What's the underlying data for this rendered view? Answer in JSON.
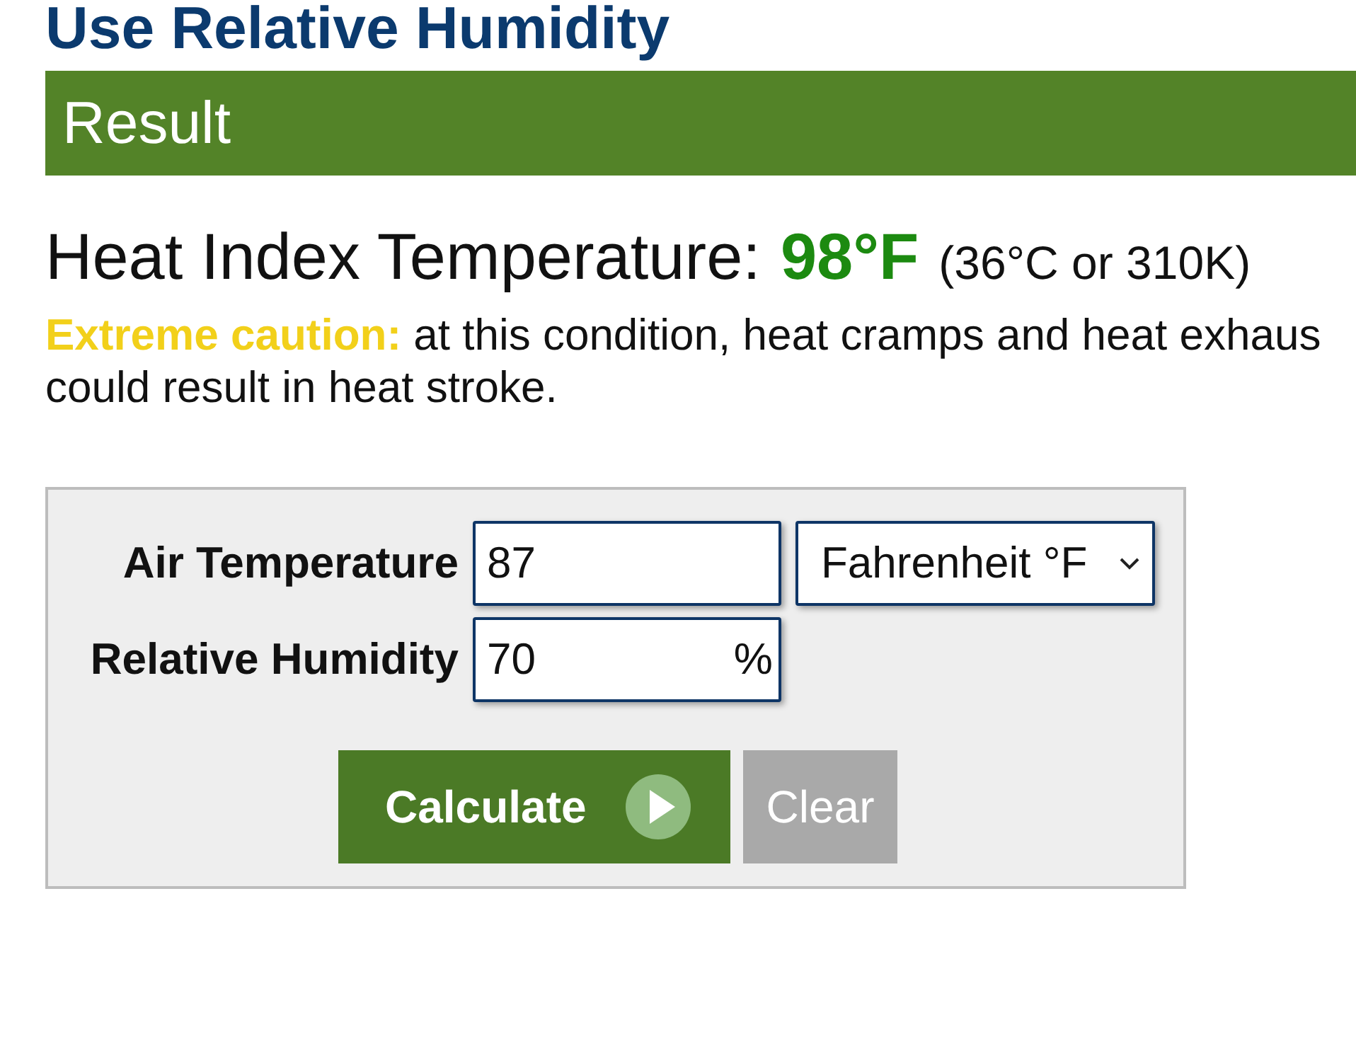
{
  "heading": "Use Relative Humidity",
  "result": {
    "title": "Result",
    "label": "Heat Index Temperature:",
    "value": "98°F",
    "conversion": "(36°C or 310K)",
    "warning_lines": [
      "**Extreme caution:** at this condition, heat cramps and heat exhaus",
      "could result in heat stroke."
    ]
  },
  "form": {
    "fields": [
      {
        "label": "Air Temperature",
        "value": "87",
        "kind": "unit-select",
        "unit": "Fahrenheit °F"
      },
      {
        "label": "Relative Humidity",
        "value": "70",
        "kind": "suffix",
        "suffix": "%"
      }
    ],
    "buttons": [
      {
        "label": "Calculate",
        "kind": "primary"
      },
      {
        "label": "Clear",
        "kind": "secondary"
      }
    ]
  }
}
